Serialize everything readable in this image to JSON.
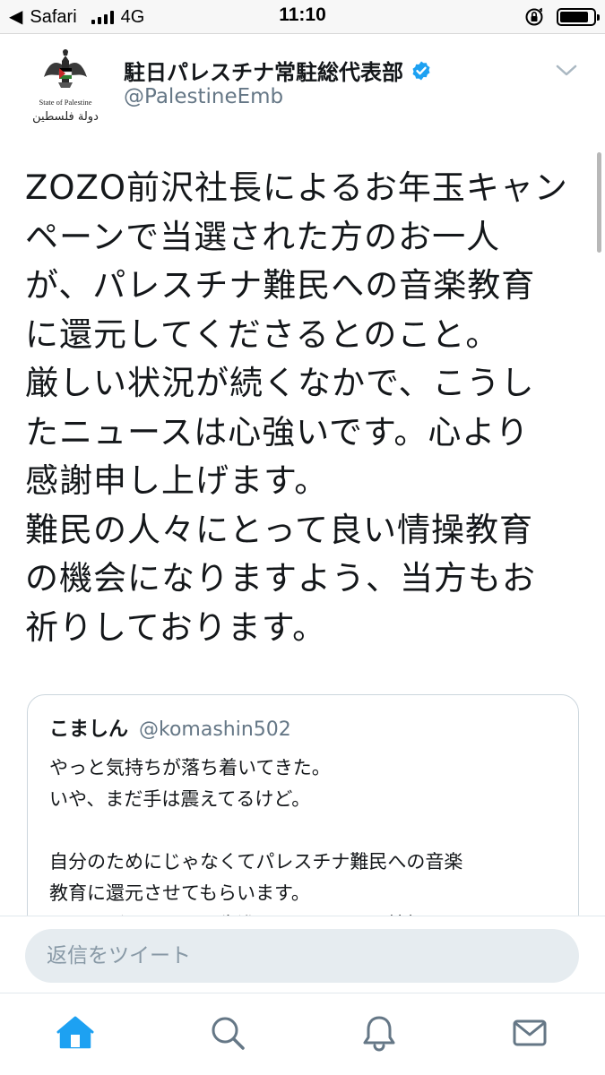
{
  "status_bar": {
    "back_app": "Safari",
    "network": "4G",
    "time": "11:10",
    "signal_bars": 4,
    "battery_level": 0.85
  },
  "tweet": {
    "author_name": "駐日パレスチナ常駐総代表部",
    "author_handle": "@PalestineEmb",
    "avatar_caption": "State of Palestine",
    "avatar_arabic": "دولة فلسطين",
    "verified": true,
    "text_lines": [
      "ZOZO前沢社長によるお年玉キャン",
      "ペーンで当選された方のお一人",
      "が、パレスチナ難民への音楽教育",
      "に還元してくださるとのこと。",
      "厳しい状況が続くなかで、こうし",
      "たニュースは心強いです。心より",
      "感謝申し上げます。",
      "難民の人々にとって良い情操教育",
      "の機会になりますよう、当方もお",
      "祈りしております。"
    ]
  },
  "quote": {
    "name": "こましん",
    "handle": "@komashin502",
    "lines": [
      "やっと気持ちが落ち着いてきた。",
      "いや、まだ手は震えてるけど。",
      "",
      "自分のためにじゃなくてパレスチナ難民への音楽",
      "教育に還元させてもらいます。",
      "この子どもたちにも先進国と同じように情操"
    ]
  },
  "reply": {
    "placeholder": "返信をツイート"
  },
  "nav": {
    "items": [
      "home-icon",
      "search-icon",
      "notifications-icon",
      "messages-icon"
    ],
    "active": "home-icon"
  },
  "colors": {
    "accent": "#1da1f2",
    "text": "#14171a",
    "secondary": "#657786",
    "icon_inactive": "#657786"
  }
}
